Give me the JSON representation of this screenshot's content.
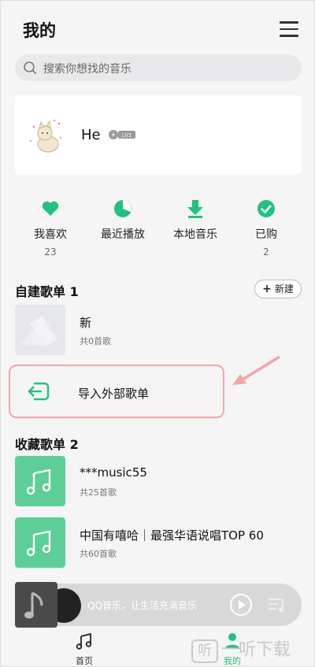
{
  "header": {
    "title": "我的",
    "menu_icon": "menu-icon"
  },
  "search": {
    "placeholder": "搜索你想找的音乐",
    "icon": "search-icon"
  },
  "profile": {
    "name": "He",
    "badge": "LV1",
    "avatar_icon": "cat-avatar"
  },
  "stats": [
    {
      "label": "我喜欢",
      "count": "23",
      "icon": "heart-icon"
    },
    {
      "label": "最近播放",
      "count": "",
      "icon": "clock-icon"
    },
    {
      "label": "本地音乐",
      "count": "",
      "icon": "download-icon"
    },
    {
      "label": "已购",
      "count": "2",
      "icon": "check-icon"
    }
  ],
  "self_built": {
    "title": "自建歌单 1",
    "new_button": "新建",
    "playlists": [
      {
        "name": "新",
        "count": "共0首歌"
      }
    ],
    "import_label": "导入外部歌单"
  },
  "collected": {
    "title": "收藏歌单 2",
    "playlists": [
      {
        "name": "***music55",
        "count": "共25首歌"
      },
      {
        "name": "中国有嘻哈｜最强华语说唱TOP 60",
        "count": "共60首歌"
      }
    ]
  },
  "player": {
    "text": "QQ音乐，让生活充满音乐",
    "play_icon": "play-icon",
    "queue_icon": "playlist-icon"
  },
  "tabs": [
    {
      "label": "首页",
      "icon": "music-note-icon"
    },
    {
      "label": "我的",
      "icon": "person-icon"
    }
  ],
  "watermark": {
    "box": "听",
    "text": "一听下载"
  },
  "colors": {
    "accent": "#20c281",
    "highlight": "#f1a6aa",
    "cover_green": "#5ccf97"
  }
}
